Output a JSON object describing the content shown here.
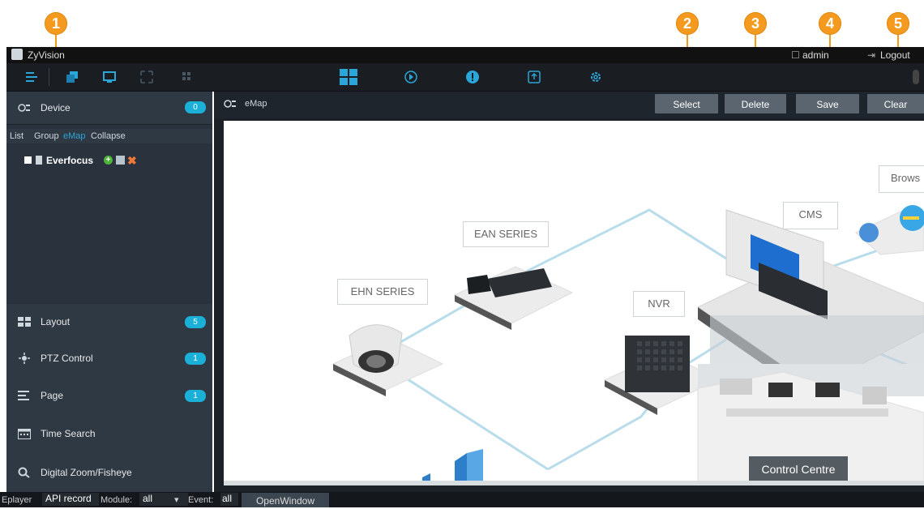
{
  "callouts": [
    "1",
    "2",
    "3",
    "4",
    "5"
  ],
  "titlebar": {
    "app_name": "ZyVision",
    "user": "admin",
    "logout": "Logout"
  },
  "device_panel": {
    "title": "Device",
    "count": "0",
    "tabs": [
      "List",
      "Group",
      "eMap",
      "Collapse"
    ],
    "active_tab": "eMap",
    "tree_item": "Everfocus"
  },
  "side_sections": [
    {
      "label": "Layout",
      "count": "5",
      "icon": "layout-icon"
    },
    {
      "label": "PTZ Control",
      "count": "1",
      "icon": "ptz-icon"
    },
    {
      "label": "Page",
      "count": "1",
      "icon": "page-icon"
    },
    {
      "label": "Time Search",
      "count": "",
      "icon": "calendar-icon"
    },
    {
      "label": "Digital Zoom/Fisheye",
      "count": "",
      "icon": "zoom-icon"
    }
  ],
  "emap": {
    "title": "eMap",
    "buttons": [
      "Select",
      "Delete",
      "Save",
      "Clear"
    ]
  },
  "map_labels": {
    "ehn": "EHN SERIES",
    "ean": "EAN SERIES",
    "nvr": "NVR",
    "cms": "CMS",
    "browser": "Brows",
    "control": "Control Centre"
  },
  "statusbar": {
    "eplayer_label": "Eplayer",
    "eplayer_value": "API record",
    "module_label": "Module:",
    "module_value": "all",
    "event_label": "Event:",
    "event_value": "all",
    "tab": "OpenWindow"
  },
  "colors": {
    "accent": "#f39a1f",
    "badge": "#1bb0d8",
    "sidebar": "#2a333d",
    "line": "#b8dcea"
  }
}
